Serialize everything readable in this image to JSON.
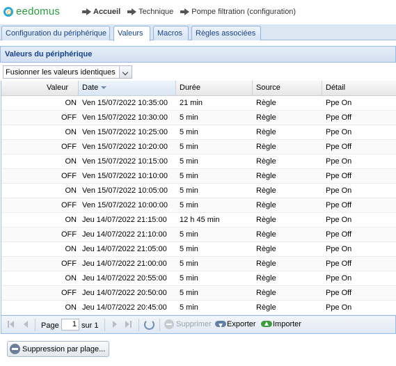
{
  "logo": {
    "text": "eedomus"
  },
  "breadcrumb": [
    {
      "label": "Accueil",
      "bold": true
    },
    {
      "label": "Technique",
      "bold": false
    },
    {
      "label": "Pompe filtration (configuration)",
      "bold": false
    }
  ],
  "tabs": [
    {
      "label": "Configuration du périphérique",
      "active": false
    },
    {
      "label": "Valeurs",
      "active": true
    },
    {
      "label": "Macros",
      "active": false
    },
    {
      "label": "Règles associées",
      "active": false
    }
  ],
  "panel": {
    "title": "Valeurs du périphérique"
  },
  "merge_select": {
    "value": "Fusionner les valeurs identiques"
  },
  "grid": {
    "columns": [
      "Valeur",
      "Date",
      "Durée",
      "Source",
      "Détail"
    ],
    "sorted_column": "Date",
    "rows": [
      [
        "ON",
        "Ven 15/07/2022 10:35:00",
        "21 min",
        "Règle",
        "Ppe On"
      ],
      [
        "OFF",
        "Ven 15/07/2022 10:30:00",
        "5 min",
        "Règle",
        "Ppe Off"
      ],
      [
        "ON",
        "Ven 15/07/2022 10:25:00",
        "5 min",
        "Règle",
        "Ppe On"
      ],
      [
        "OFF",
        "Ven 15/07/2022 10:20:00",
        "5 min",
        "Règle",
        "Ppe Off"
      ],
      [
        "ON",
        "Ven 15/07/2022 10:15:00",
        "5 min",
        "Règle",
        "Ppe On"
      ],
      [
        "OFF",
        "Ven 15/07/2022 10:10:00",
        "5 min",
        "Règle",
        "Ppe Off"
      ],
      [
        "ON",
        "Ven 15/07/2022 10:05:00",
        "5 min",
        "Règle",
        "Ppe On"
      ],
      [
        "OFF",
        "Ven 15/07/2022 10:00:00",
        "5 min",
        "Règle",
        "Ppe Off"
      ],
      [
        "ON",
        "Jeu 14/07/2022 21:15:00",
        "12 h 45 min",
        "Règle",
        "Ppe On"
      ],
      [
        "OFF",
        "Jeu 14/07/2022 21:10:00",
        "5 min",
        "Règle",
        "Ppe Off"
      ],
      [
        "ON",
        "Jeu 14/07/2022 21:05:00",
        "5 min",
        "Règle",
        "Ppe On"
      ],
      [
        "OFF",
        "Jeu 14/07/2022 21:00:00",
        "5 min",
        "Règle",
        "Ppe Off"
      ],
      [
        "ON",
        "Jeu 14/07/2022 20:55:00",
        "5 min",
        "Règle",
        "Ppe On"
      ],
      [
        "OFF",
        "Jeu 14/07/2022 20:50:00",
        "5 min",
        "Règle",
        "Ppe Off"
      ],
      [
        "ON",
        "Jeu 14/07/2022 20:45:00",
        "5 min",
        "Règle",
        "Ppe On"
      ]
    ]
  },
  "pager": {
    "page_label": "Page",
    "page_value": "1",
    "of_label": "sur 1",
    "delete_label": "Supprimer",
    "export_label": "Exporter",
    "import_label": "Importer"
  },
  "range_button": {
    "label": "Suppression par plage..."
  },
  "colors": {
    "accent": "#15428b",
    "logo_green": "#2a9b3f",
    "border": "#99bbe8"
  }
}
